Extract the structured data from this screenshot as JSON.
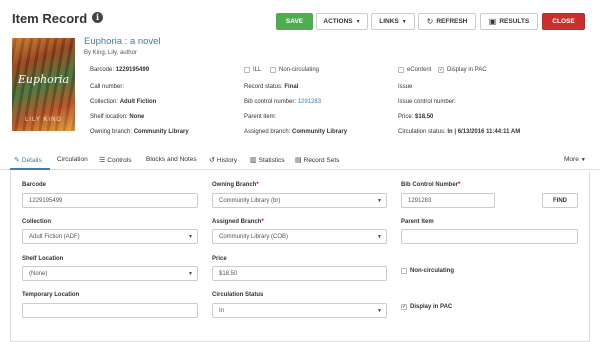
{
  "header": {
    "title": "Item Record",
    "buttons": {
      "save": "SAVE",
      "actions": "ACTIONS",
      "links": "LINKS",
      "refresh": "REFRESH",
      "results": "RESULTS",
      "close": "CLOSE"
    }
  },
  "book": {
    "title": "Euphoria : a novel",
    "author": "By King, Lily, author",
    "cover_title": "Euphoria",
    "cover_author": "LILY KING"
  },
  "summary": {
    "col1": {
      "barcode_label": "Barcode:",
      "barcode_value": "1229195499",
      "call_number_label": "Call number:",
      "collection_label": "Collection:",
      "collection_value": "Adult Fiction",
      "shelf_label": "Shelf location:",
      "shelf_value": "None",
      "owning_label": "Owning branch:",
      "owning_value": "Community Library"
    },
    "col2": {
      "ill": "ILL",
      "non_circ": "Non-circulating",
      "record_status_label": "Record status:",
      "record_status_value": "Final",
      "bib_label": "Bib control number:",
      "bib_value": "1291283",
      "parent_label": "Parent item:",
      "assigned_label": "Assigned branch:",
      "assigned_value": "Community Library"
    },
    "col3": {
      "econtent": "eContent",
      "display_pac": "Display in PAC",
      "issue_label": "Issue",
      "issue_ctrl_label": "Issue control number:",
      "price_label": "Price:",
      "price_value": "$18.50",
      "circ_status_label": "Circulation status:",
      "circ_status_value": "In | 6/13/2016 11:44:11 AM"
    }
  },
  "tabs": [
    {
      "label": "Details",
      "icon": "edit-icon"
    },
    {
      "label": "Circulation",
      "icon": ""
    },
    {
      "label": "Controls",
      "icon": "list-icon"
    },
    {
      "label": "Blocks and Notes",
      "icon": ""
    },
    {
      "label": "History",
      "icon": "history-icon"
    },
    {
      "label": "Statistics",
      "icon": "chart-icon"
    },
    {
      "label": "Record Sets",
      "icon": "record-sets-icon"
    },
    {
      "label": "More",
      "icon": "caret-icon"
    }
  ],
  "form": {
    "barcode": {
      "label": "Barcode",
      "value": "1229195499"
    },
    "owning_branch": {
      "label": "Owning Branch",
      "value": "Community Library (br)"
    },
    "bib_control": {
      "label": "Bib Control Number",
      "value": "1291283"
    },
    "find": "FIND",
    "collection": {
      "label": "Collection",
      "value": "Adult Fiction (ADF)"
    },
    "assigned_branch": {
      "label": "Assigned Branch",
      "value": "Community Library (COB)"
    },
    "parent_item": {
      "label": "Parent Item",
      "value": ""
    },
    "shelf_location": {
      "label": "Shelf Location",
      "value": "(None)"
    },
    "price": {
      "label": "Price",
      "value": "$18.50"
    },
    "non_circulating": "Non-circulating",
    "temporary_location": {
      "label": "Temporary Location",
      "value": ""
    },
    "circulation_status": {
      "label": "Circulation Status",
      "value": "In"
    },
    "display_in_pac": "Display in PAC"
  },
  "colors": {
    "save": "#4cae4c",
    "close": "#c9302c",
    "link": "#3a7fb0"
  }
}
